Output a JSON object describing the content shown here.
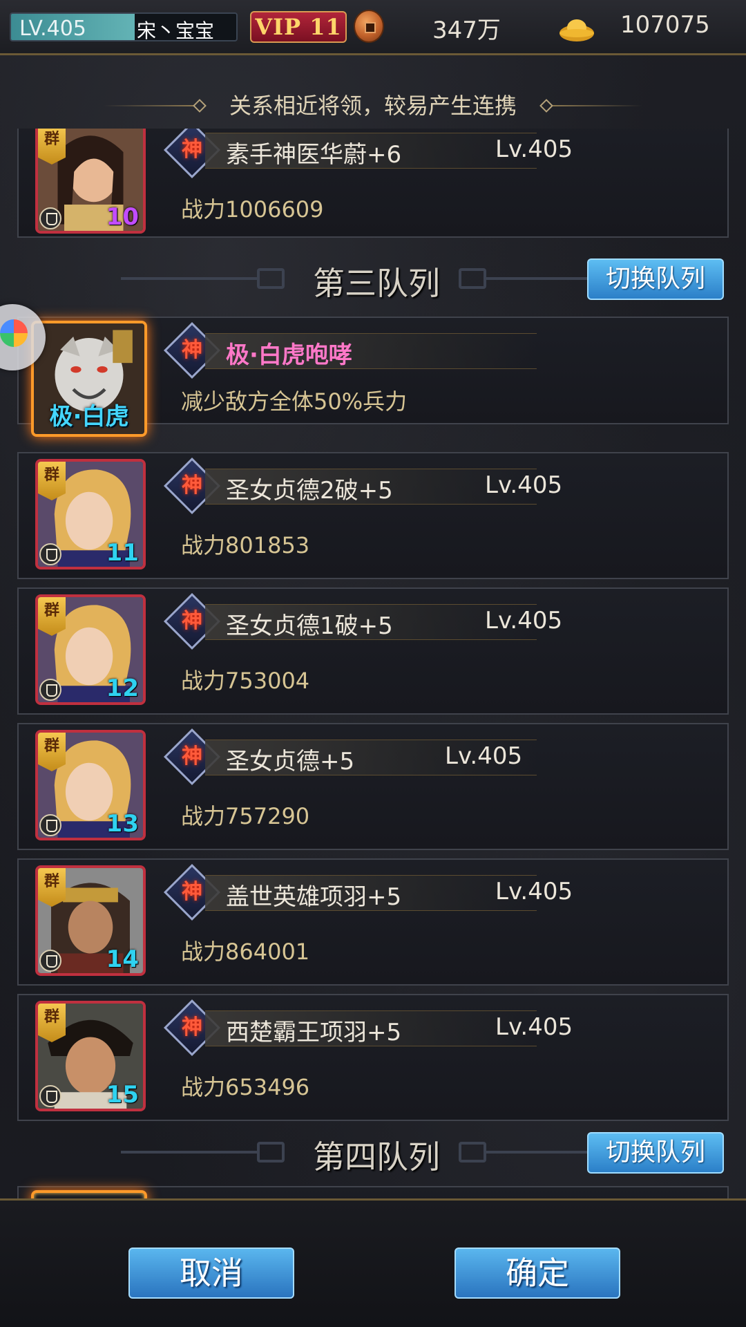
{
  "status_bar": {
    "level": "LV.405",
    "level_progress": 0.55,
    "player_name": "宋丶宝宝",
    "vip": "VIP 11",
    "copper": "347万",
    "gold": "107075"
  },
  "hint": "关系相近将领，较易产生连携",
  "cards_top": [
    {
      "faction": "群",
      "name": "素手神医华蔚+6",
      "level": "Lv.405",
      "power": "战力1006609",
      "slot": "10"
    }
  ],
  "section3": {
    "title": "第三队列",
    "switch_label": "切换队列"
  },
  "legend_card": {
    "portrait_label": "极·白虎",
    "skill_name": "极·白虎咆哮",
    "skill_desc": "减少敌方全体50%兵力"
  },
  "cards_section3": [
    {
      "faction": "群",
      "name": "圣女贞德2破+5",
      "level": "Lv.405",
      "power": "战力801853",
      "slot": "11"
    },
    {
      "faction": "群",
      "name": "圣女贞德1破+5",
      "level": "Lv.405",
      "power": "战力753004",
      "slot": "12"
    },
    {
      "faction": "群",
      "name": "圣女贞德+5",
      "level": "Lv.405",
      "power": "战力757290",
      "slot": "13"
    },
    {
      "faction": "群",
      "name": "盖世英雄项羽+5",
      "level": "Lv.405",
      "power": "战力864001",
      "slot": "14"
    },
    {
      "faction": "群",
      "name": "西楚霸王项羽+5",
      "level": "Lv.405",
      "power": "战力653496",
      "slot": "15"
    }
  ],
  "god_char": "神",
  "section4": {
    "title": "第四队列",
    "switch_label": "切换队列"
  },
  "buttons": {
    "cancel": "取消",
    "confirm": "确定"
  },
  "colors": {
    "accent_blue": "#3a8fd6",
    "slot_cyan": "#2fd2f0",
    "skill_pink": "#ff78c8",
    "frame_red": "#c0303f"
  }
}
